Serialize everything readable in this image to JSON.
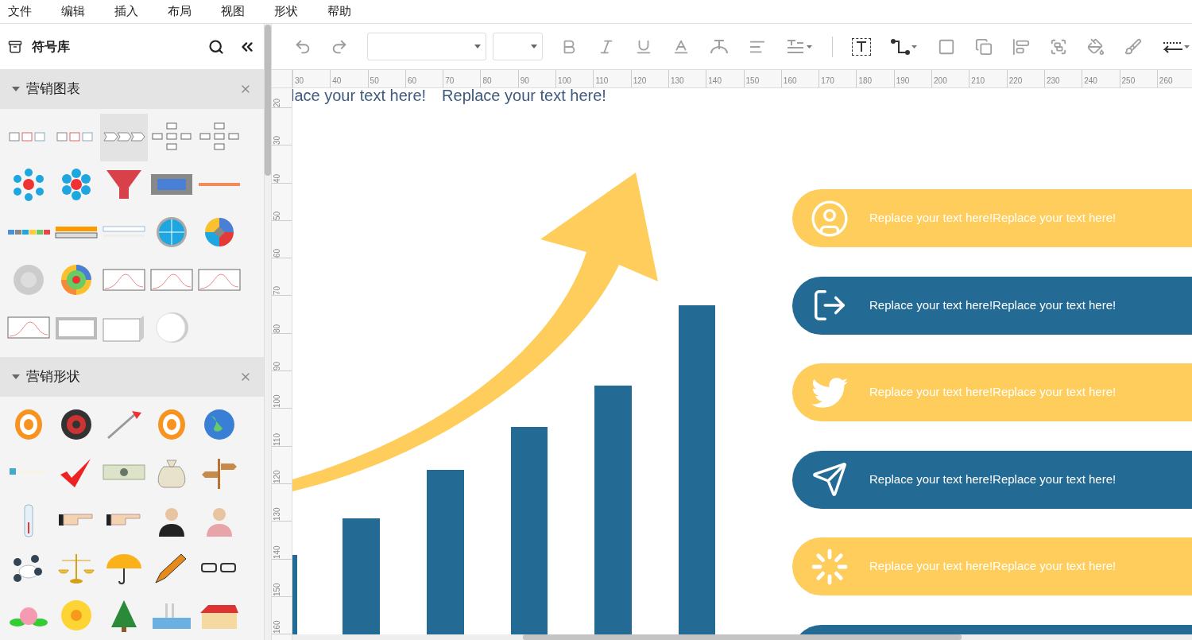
{
  "menu": [
    "文件",
    "编辑",
    "插入",
    "布局",
    "视图",
    "形状",
    "帮助"
  ],
  "library": {
    "title": "符号库",
    "sections": [
      {
        "title": "营销图表",
        "expanded": true,
        "items": [
          {
            "kind": "flow",
            "selected": false
          },
          {
            "kind": "flow",
            "selected": false
          },
          {
            "kind": "chevrons",
            "selected": true
          },
          {
            "kind": "tree",
            "selected": false
          },
          {
            "kind": "tree",
            "selected": false
          },
          {
            "kind": "cycle",
            "selected": false
          },
          {
            "kind": "hex",
            "selected": false
          },
          {
            "kind": "funnel",
            "selected": false
          },
          {
            "kind": "frame",
            "selected": false
          },
          {
            "kind": "ribbon",
            "selected": false
          },
          {
            "kind": "arrows",
            "selected": false
          },
          {
            "kind": "gradient",
            "selected": false
          },
          {
            "kind": "timeline",
            "selected": false
          },
          {
            "kind": "wheel",
            "selected": false
          },
          {
            "kind": "quad",
            "selected": false
          },
          {
            "kind": "ring",
            "selected": false
          },
          {
            "kind": "donut",
            "selected": false
          },
          {
            "kind": "wave",
            "selected": false
          },
          {
            "kind": "wave",
            "selected": false
          },
          {
            "kind": "wave",
            "selected": false
          },
          {
            "kind": "wave",
            "selected": false
          },
          {
            "kind": "panel",
            "selected": false
          },
          {
            "kind": "block",
            "selected": false
          },
          {
            "kind": "disc",
            "selected": false
          }
        ]
      },
      {
        "title": "营销形状",
        "expanded": true,
        "items": [
          {
            "kind": "target",
            "selected": false
          },
          {
            "kind": "dartboard",
            "selected": false
          },
          {
            "kind": "dart",
            "selected": false
          },
          {
            "kind": "target",
            "selected": false
          },
          {
            "kind": "globe",
            "selected": false
          },
          {
            "kind": "checkbox",
            "selected": false
          },
          {
            "kind": "check",
            "selected": false
          },
          {
            "kind": "bill",
            "selected": false
          },
          {
            "kind": "bag",
            "selected": false
          },
          {
            "kind": "sign",
            "selected": false
          },
          {
            "kind": "thermo",
            "selected": false
          },
          {
            "kind": "hand",
            "selected": false
          },
          {
            "kind": "hand",
            "selected": false
          },
          {
            "kind": "man",
            "selected": false
          },
          {
            "kind": "woman",
            "selected": false
          },
          {
            "kind": "meeting",
            "selected": false
          },
          {
            "kind": "scale",
            "selected": false
          },
          {
            "kind": "umbrella",
            "selected": false
          },
          {
            "kind": "pencil",
            "selected": false
          },
          {
            "kind": "glasses",
            "selected": false
          },
          {
            "kind": "rose",
            "selected": false
          },
          {
            "kind": "flower",
            "selected": false
          },
          {
            "kind": "pine",
            "selected": false
          },
          {
            "kind": "factory",
            "selected": false
          },
          {
            "kind": "house",
            "selected": false
          }
        ]
      }
    ]
  },
  "ruler": {
    "horizontal": [
      "30",
      "40",
      "50",
      "60",
      "70",
      "80",
      "90",
      "100",
      "110",
      "120",
      "130",
      "140",
      "150",
      "160",
      "170",
      "180",
      "190",
      "200",
      "210",
      "220",
      "230",
      "240",
      "250",
      "260"
    ],
    "vertical": [
      "20",
      "30",
      "40",
      "50",
      "60",
      "70",
      "80",
      "90",
      "100",
      "110",
      "120",
      "130",
      "140",
      "150",
      "160"
    ]
  },
  "canvas": {
    "headings": [
      "lace your text here!",
      "Replace your text here!"
    ],
    "pills": [
      {
        "color": "#fecd5b",
        "kind": "person",
        "text": "Replace your text here!Replace your text here!"
      },
      {
        "color": "#236a94",
        "kind": "exit",
        "text": "Replace your text here!Replace your text here!"
      },
      {
        "color": "#fecd5b",
        "kind": "bird",
        "text": "Replace your text here!Replace your text here!"
      },
      {
        "color": "#236a94",
        "kind": "send",
        "text": "Replace your text here!Replace your text here!"
      },
      {
        "color": "#fecd5b",
        "kind": "loader",
        "text": "Replace your text here!Replace your text here!"
      },
      {
        "color": "#236a94"
      }
    ]
  }
}
